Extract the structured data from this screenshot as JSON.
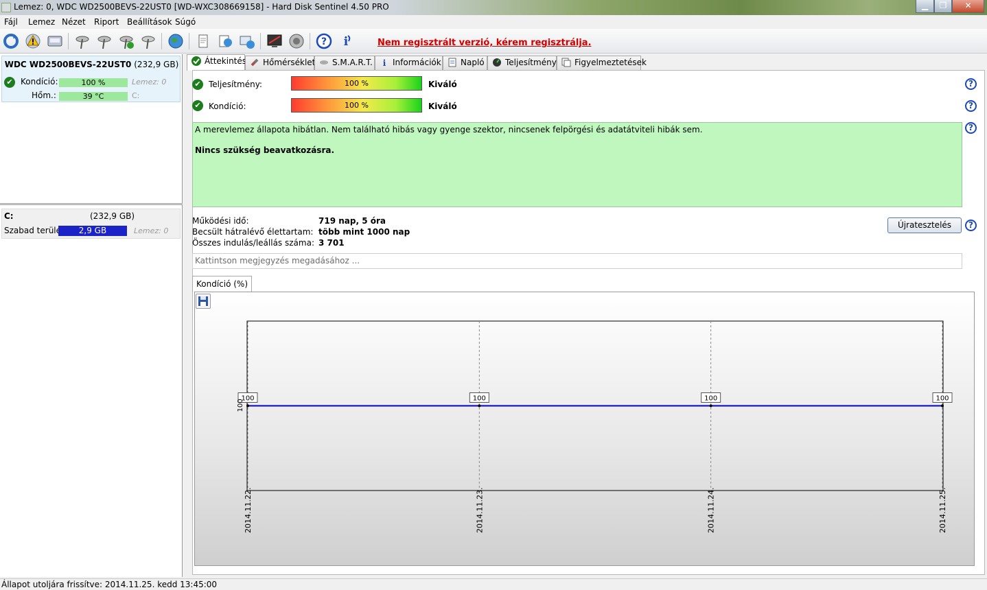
{
  "window": {
    "title": "Lemez: 0, WDC WD2500BEVS-22UST0 [WD-WXC308669158]  -  Hard Disk Sentinel 4.50 PRO",
    "minimize": "▁",
    "maximize": "❐",
    "close": "✕"
  },
  "menu": [
    "Fájl",
    "Lemez",
    "Nézet",
    "Riport",
    "Beállítások",
    "Súgó"
  ],
  "toolbar": {
    "register_note": "Nem regisztrált verzió, kérem regisztrálja."
  },
  "disk": {
    "name": "WDC WD2500BEVS-22UST0",
    "size": "(232,9 GB)",
    "condition_label": "Kondíció:",
    "condition_value": "100 %",
    "condition_disk": "Lemez: 0",
    "temp_label": "Hőm.:",
    "temp_value": "39 °C",
    "temp_drive": "C:"
  },
  "volume": {
    "drive": "C:",
    "size": "(232,9 GB)",
    "free_label": "Szabad terület",
    "free_value": "2,9 GB",
    "disk": "Lemez: 0"
  },
  "tabs": [
    "Áttekintés",
    "Hőmérséklet",
    "S.M.A.R.T.",
    "Információk",
    "Napló",
    "Teljesítmény",
    "Figyelmeztetések"
  ],
  "overview": {
    "perf_label": "Teljesítmény:",
    "perf_value": "100 %",
    "perf_rating": "Kiváló",
    "cond_label": "Kondíció:",
    "cond_value": "100 %",
    "cond_rating": "Kiváló",
    "status_text": "A merevlemez állapota hibátlan. Nem található hibás vagy gyenge szektor, nincsenek felpörgési és adatátviteli hibák sem.",
    "status_action": "Nincs szükség beavatkozásra.",
    "uptime_label": "Működési idő:",
    "uptime_value": "719 nap, 5 óra",
    "lifetime_label": "Becsült hátralévő élettartam:",
    "lifetime_value": "több mint 1000 nap",
    "startstop_label": "Összes indulás/leállás száma:",
    "startstop_value": "3 701",
    "retest_button": "Újratesztelés",
    "note_placeholder": "Kattintson megjegyzés megadásához ...",
    "help": "?"
  },
  "chart_tab": "Kondíció  (%)",
  "chart_data": {
    "type": "line",
    "x": [
      "2014.11.22.",
      "2014.11.23.",
      "2014.11.24.",
      "2014.11.25."
    ],
    "series": [
      {
        "values": [
          100,
          100,
          100,
          100
        ]
      }
    ],
    "y_tick": "100",
    "grid": true,
    "line_color": "#0000cc"
  },
  "statusbar": "Állapot utoljára frissítve: 2014.11.25. kedd 13:45:00"
}
